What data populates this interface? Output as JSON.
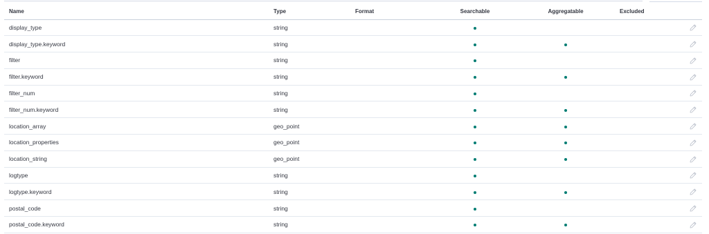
{
  "colors": {
    "dot": "#017d73",
    "border": "#e3e8ef",
    "text": "#343741",
    "pencil": "#b4bac6"
  },
  "icons": {
    "searchable": "filled-dot-icon",
    "aggregatable": "filled-dot-icon",
    "edit": "pencil-icon"
  },
  "table": {
    "headers": {
      "name": "Name",
      "type": "Type",
      "format": "Format",
      "searchable": "Searchable",
      "aggregatable": "Aggregatable",
      "excluded": "Excluded"
    },
    "rows": [
      {
        "name": "display_type",
        "type": "string",
        "format": "",
        "searchable": true,
        "aggregatable": false,
        "excluded": false
      },
      {
        "name": "display_type.keyword",
        "type": "string",
        "format": "",
        "searchable": true,
        "aggregatable": true,
        "excluded": false
      },
      {
        "name": "filter",
        "type": "string",
        "format": "",
        "searchable": true,
        "aggregatable": false,
        "excluded": false
      },
      {
        "name": "filter.keyword",
        "type": "string",
        "format": "",
        "searchable": true,
        "aggregatable": true,
        "excluded": false
      },
      {
        "name": "filter_num",
        "type": "string",
        "format": "",
        "searchable": true,
        "aggregatable": false,
        "excluded": false
      },
      {
        "name": "filter_num.keyword",
        "type": "string",
        "format": "",
        "searchable": true,
        "aggregatable": true,
        "excluded": false
      },
      {
        "name": "location_array",
        "type": "geo_point",
        "format": "",
        "searchable": true,
        "aggregatable": true,
        "excluded": false
      },
      {
        "name": "location_properties",
        "type": "geo_point",
        "format": "",
        "searchable": true,
        "aggregatable": true,
        "excluded": false
      },
      {
        "name": "location_string",
        "type": "geo_point",
        "format": "",
        "searchable": true,
        "aggregatable": true,
        "excluded": false
      },
      {
        "name": "logtype",
        "type": "string",
        "format": "",
        "searchable": true,
        "aggregatable": false,
        "excluded": false
      },
      {
        "name": "logtype.keyword",
        "type": "string",
        "format": "",
        "searchable": true,
        "aggregatable": true,
        "excluded": false
      },
      {
        "name": "postal_code",
        "type": "string",
        "format": "",
        "searchable": true,
        "aggregatable": false,
        "excluded": false
      },
      {
        "name": "postal_code.keyword",
        "type": "string",
        "format": "",
        "searchable": true,
        "aggregatable": true,
        "excluded": false
      }
    ]
  }
}
